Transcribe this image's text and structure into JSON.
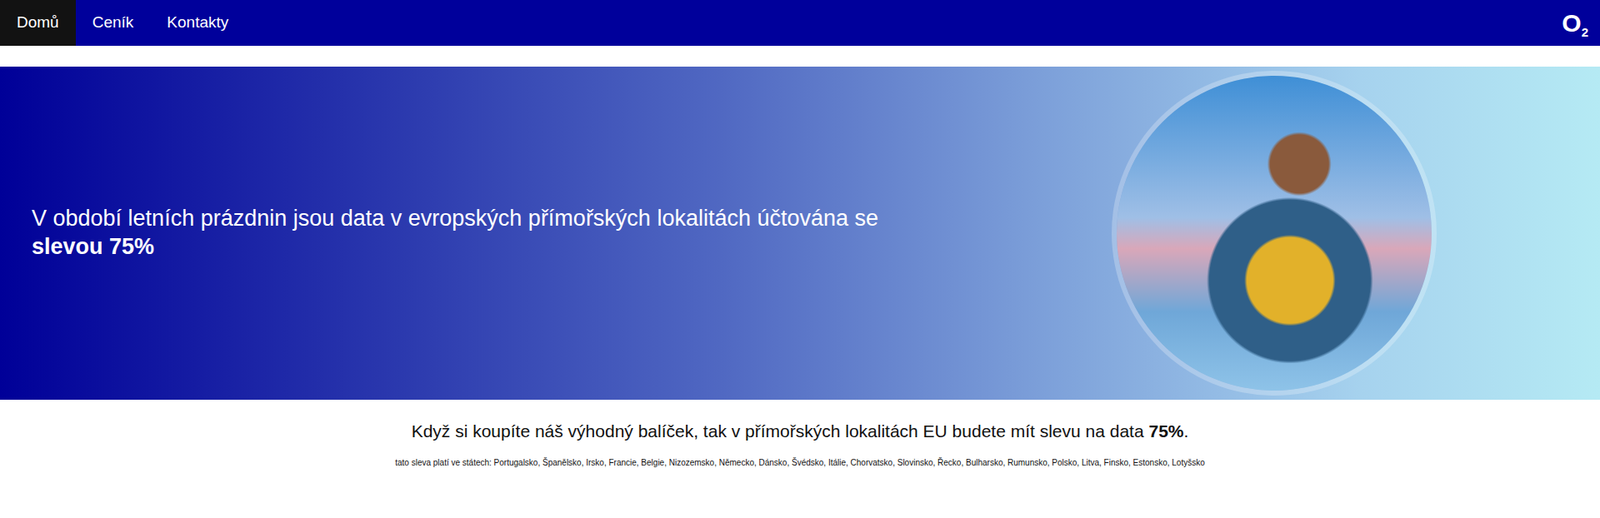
{
  "nav": {
    "items": [
      {
        "label": "Domů",
        "selected": true
      },
      {
        "label": "Ceník",
        "selected": false
      },
      {
        "label": "Kontakty",
        "selected": false
      }
    ],
    "logo": {
      "letter": "O",
      "sub": "2"
    }
  },
  "hero": {
    "text": "V období letních prázdnin jsou data v evropských přímořských lokalitách účtována se",
    "bold": "slevou 75%"
  },
  "offer": {
    "text": "Když si koupíte náš výhodný balíček, tak v přímořských lokalitách EU budete mít slevu na data",
    "bold": "75%",
    "end": "."
  },
  "note": "tato sleva platí ve státech: Portugalsko, Španělsko, Irsko, Francie, Belgie, Nizozemsko, Německo, Dánsko, Švédsko, Itálie, Chorvatsko, Slovinsko, Řecko, Bulharsko, Rumunsko, Polsko, Litva, Finsko, Estonsko, Lotyšsko"
}
